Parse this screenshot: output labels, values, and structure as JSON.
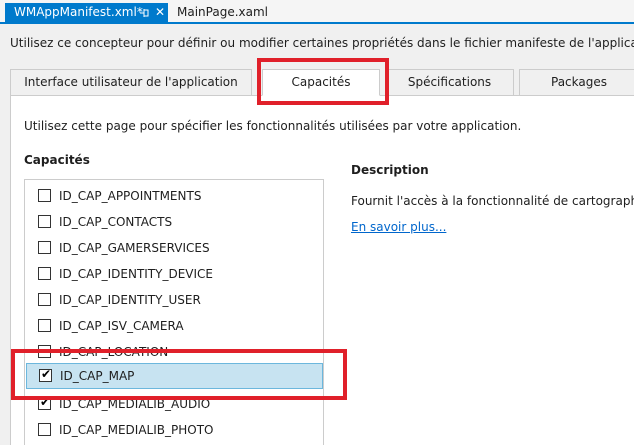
{
  "doc_tabs": {
    "active_label": "WMAppManifest.xml*",
    "pin_icon": "pin-icon",
    "close_glyph": "✕",
    "inactive_label": "MainPage.xaml"
  },
  "intro_text": "Utilisez ce concepteur pour définir ou modifier certaines propriétés dans le fichier manifeste de l'application Windows",
  "designer_tabs": [
    {
      "label": "Interface utilisateur de l'application"
    },
    {
      "label": "Capacités"
    },
    {
      "label": "Spécifications"
    },
    {
      "label": "Packages"
    }
  ],
  "content": {
    "hint": "Utilisez cette page pour spécifier les fonctionnalités utilisées par votre application.",
    "capabilities_heading": "Capacités",
    "items": [
      {
        "label": "ID_CAP_APPOINTMENTS",
        "checked": false
      },
      {
        "label": "ID_CAP_CONTACTS",
        "checked": false
      },
      {
        "label": "ID_CAP_GAMERSERVICES",
        "checked": false
      },
      {
        "label": "ID_CAP_IDENTITY_DEVICE",
        "checked": false
      },
      {
        "label": "ID_CAP_IDENTITY_USER",
        "checked": false
      },
      {
        "label": "ID_CAP_ISV_CAMERA",
        "checked": false
      },
      {
        "label": "ID_CAP_LOCATION",
        "checked": false
      },
      {
        "label": "ID_CAP_MAP",
        "checked": true,
        "selected": true
      },
      {
        "label": "ID_CAP_MEDIALIB_AUDIO",
        "checked": true
      },
      {
        "label": "ID_CAP_MEDIALIB_PHOTO",
        "checked": false
      }
    ],
    "description_heading": "Description",
    "description_text": "Fournit l'accès à la fonctionnalité de cartographie.",
    "learn_more": "En savoir plus..."
  },
  "colors": {
    "accent": "#007acc",
    "selection": "#c7e3f1",
    "highlight": "#e0202a",
    "link": "#0066cc"
  }
}
